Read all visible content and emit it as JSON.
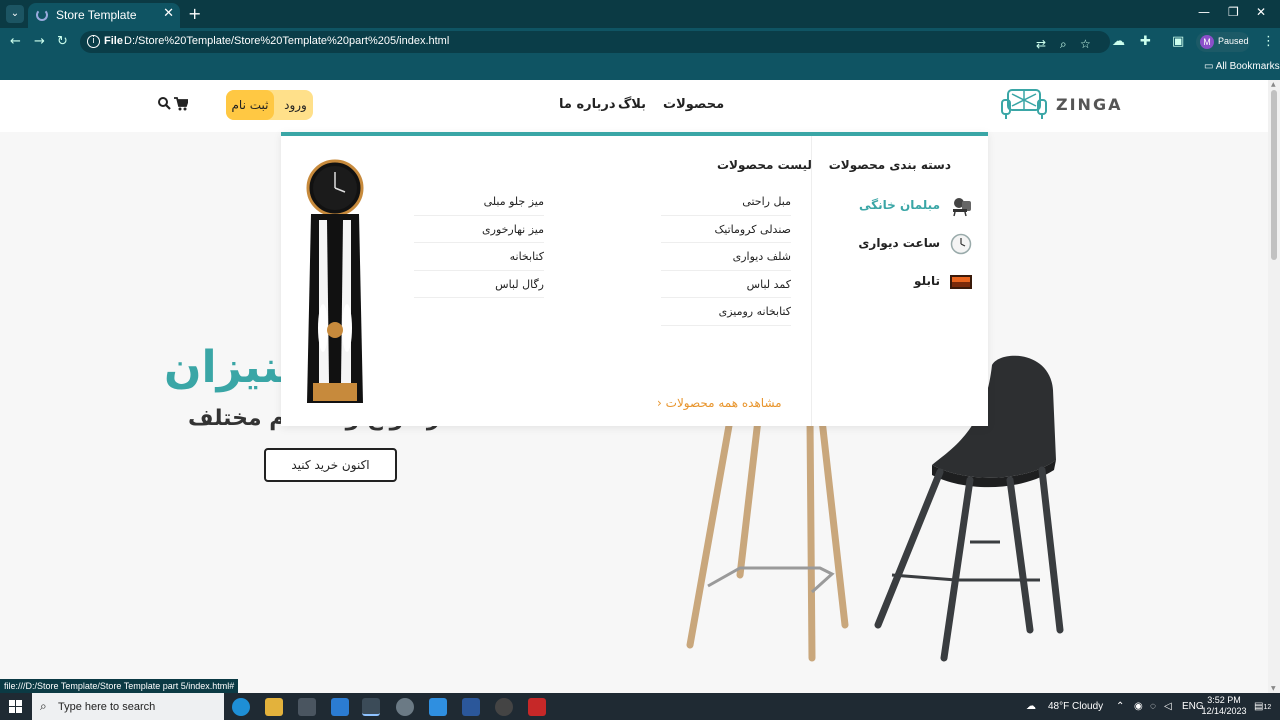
{
  "browser": {
    "tab_title": "Store Template",
    "url_scheme": "File",
    "url": "D:/Store%20Template/Store%20Template%20part%205/index.html",
    "profile_initial": "M",
    "profile_status": "Paused",
    "bookmarks_label": "All Bookmarks",
    "status_url": "file:///D:/Store Template/Store Template part 5/index.html#"
  },
  "header": {
    "logo_text": "ZINGA",
    "nav": [
      "محصولات",
      "بلاگ",
      "درباره ما"
    ],
    "login_label": "ورود",
    "signup_label": "ثبت نام"
  },
  "hero": {
    "title": "بنیزان",
    "subtitle": "در انواع و اقسام مختلف",
    "button_label": "اکنون خرید کنید"
  },
  "mega_menu": {
    "categories_title": "دسته بندی محصولات",
    "categories": [
      {
        "label": "مبلمان خانگی",
        "active": true,
        "icon": "furniture-icon"
      },
      {
        "label": "ساعت دیواری",
        "active": false,
        "icon": "wall-clock-icon"
      },
      {
        "label": "تابلو",
        "active": false,
        "icon": "painting-icon"
      }
    ],
    "products_title": "لیست محصولات",
    "products_right": [
      "مبل راحتی",
      "صندلی کروماتیک",
      "شلف دیواری",
      "کمد لباس",
      "کتابخانه رومیزی"
    ],
    "products_left": [
      "میز جلو مبلی",
      "میز نهارخوری",
      "کتابخانه",
      "رگال لباس"
    ],
    "view_all": "مشاهده همه محصولات"
  },
  "taskbar": {
    "search_placeholder": "Type here to search",
    "weather": "48°F  Cloudy",
    "lang": "ENG",
    "time": "3:52 PM",
    "date": "12/14/2023",
    "notif_count": "12"
  },
  "colors": {
    "accent": "#3aa6a6",
    "cta": "#ffc843",
    "view_all": "#e8952d",
    "browser": "#0f5463"
  }
}
